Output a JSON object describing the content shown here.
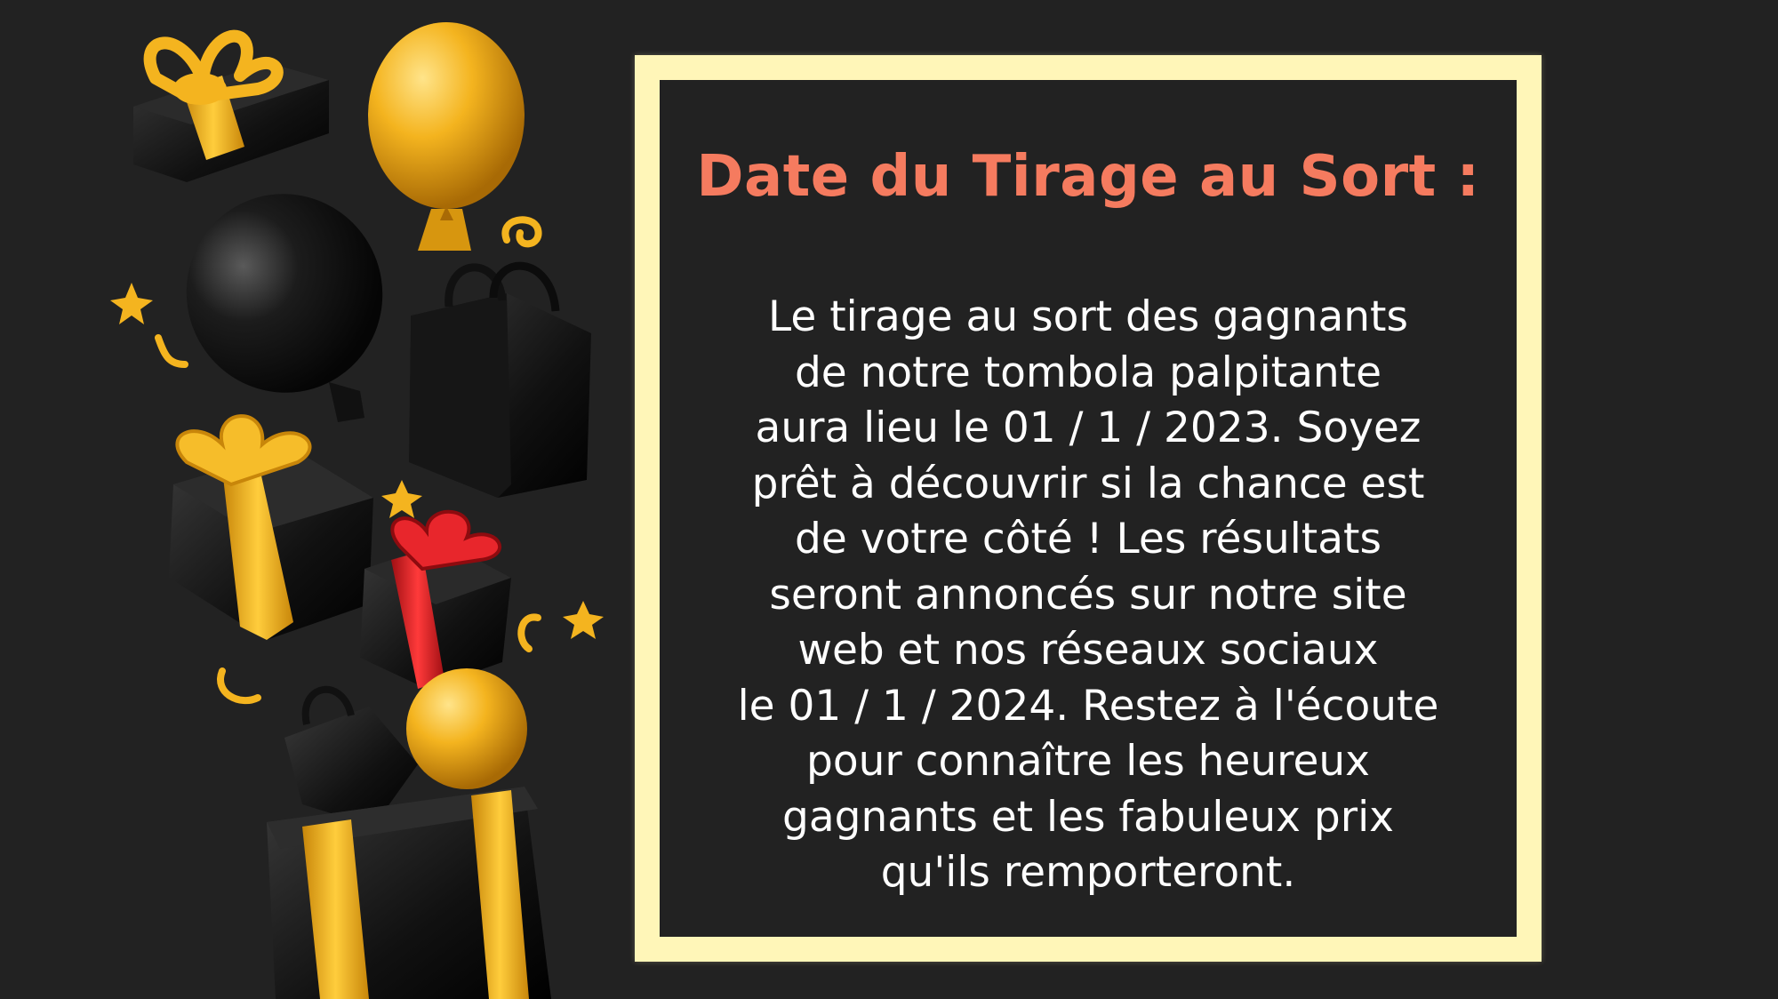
{
  "colors": {
    "background": "#222222",
    "frame": "#fff6b8",
    "heading": "#f57b5f",
    "text": "#ffffff",
    "gold": "#f2b01e",
    "red": "#e01f26"
  },
  "illustration": {
    "items": [
      "gift-box-icon",
      "balloon-icon",
      "shopping-bag-icon",
      "star-icon",
      "confetti-icon"
    ]
  },
  "heading": "Date du Tirage au Sort :",
  "body_lines": [
    "Le tirage au sort des gagnants",
    "de notre tombola palpitante",
    "aura lieu le 01 / 1 / 2023. Soyez",
    "prêt à découvrir si la chance est",
    "de votre côté ! Les résultats",
    "seront annoncés sur notre site",
    "web et nos réseaux sociaux",
    "le 01 / 1 / 2024. Restez à l'écoute",
    "pour connaître les heureux",
    "gagnants et les fabuleux prix",
    "qu'ils remporteront."
  ]
}
